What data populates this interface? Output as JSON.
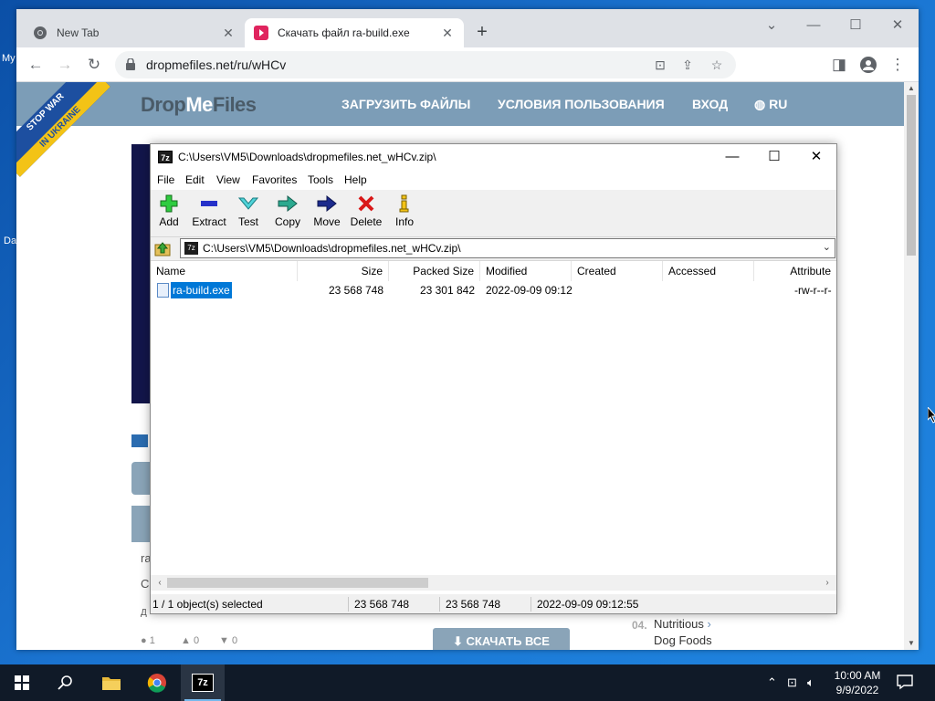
{
  "desktop": {
    "labels": [
      "My",
      "Da"
    ]
  },
  "browser": {
    "tabs": [
      {
        "title": "New Tab",
        "icon": "chrome-icon",
        "active": false
      },
      {
        "title": "Скачать файл ra-build.exe",
        "icon": "dropmefiles-favicon",
        "active": true
      }
    ],
    "url": "dropmefiles.net/ru/wHCv"
  },
  "site": {
    "logo_part1": "Drop",
    "logo_part2": "Me",
    "logo_part3": "Files",
    "ribbon_line1": "STOP WAR",
    "ribbon_line2": "IN UKRAINE",
    "nav": [
      "ЗАГРУЗИТЬ ФАЙЛЫ",
      "УСЛОВИЯ ПОЛЬЗОВАНИЯ",
      "ВХОД",
      "RU"
    ],
    "side_text_1": "ra",
    "side_text_2": "С",
    "side_text_3": "Д",
    "promo_num": "04.",
    "promo_line1": "Nutritious",
    "promo_line2": "Dog Foods",
    "download_all": "СКАЧАТЬ ВСЕ",
    "likes": "1",
    "thumbs_up": "0",
    "thumbs_down": "0"
  },
  "sevenzip": {
    "title": "C:\\Users\\VM5\\Downloads\\dropmefiles.net_wHCv.zip\\",
    "menu": [
      "File",
      "Edit",
      "View",
      "Favorites",
      "Tools",
      "Help"
    ],
    "toolbar": [
      {
        "label": "Add",
        "icon": "add-icon"
      },
      {
        "label": "Extract",
        "icon": "extract-icon"
      },
      {
        "label": "Test",
        "icon": "test-icon"
      },
      {
        "label": "Copy",
        "icon": "copy-icon"
      },
      {
        "label": "Move",
        "icon": "move-icon"
      },
      {
        "label": "Delete",
        "icon": "delete-icon"
      },
      {
        "label": "Info",
        "icon": "info-icon"
      }
    ],
    "address": "C:\\Users\\VM5\\Downloads\\dropmefiles.net_wHCv.zip\\",
    "columns": [
      "Name",
      "Size",
      "Packed Size",
      "Modified",
      "Created",
      "Accessed",
      "Attribute"
    ],
    "files": [
      {
        "name": "ra-build.exe",
        "size": "23 568 748",
        "packed": "23 301 842",
        "modified": "2022-09-09 09:12",
        "created": "",
        "accessed": "",
        "attributes": "-rw-r--r-"
      }
    ],
    "status": {
      "selection": "1 / 1 object(s) selected",
      "size": "23 568 748",
      "packed": "23 568 748",
      "modified": "2022-09-09 09:12:55"
    }
  },
  "taskbar": {
    "apps": [
      "start-button",
      "search-icon",
      "file-explorer-icon",
      "chrome-icon",
      "7zip-icon"
    ],
    "time": "10:00 AM",
    "date": "9/9/2022"
  },
  "colors": {
    "site_header": "#7c9db7",
    "selection": "#0078d7",
    "taskbar": "#101a28"
  }
}
